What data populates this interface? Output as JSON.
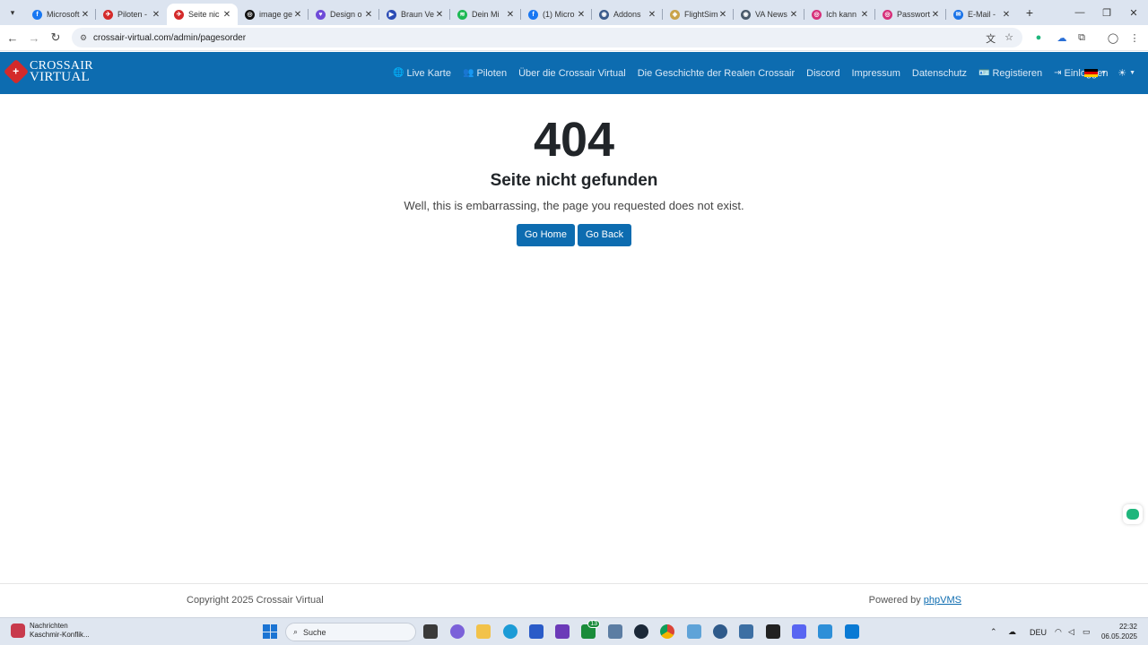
{
  "browser": {
    "tabs": [
      {
        "title": "Microsoft",
        "fav_color": "#1877f2",
        "fav_glyph": "f",
        "active": false
      },
      {
        "title": "Piloten -",
        "fav_color": "#d42a2a",
        "fav_glyph": "✈",
        "active": false
      },
      {
        "title": "Seite nic",
        "fav_color": "#d42a2a",
        "fav_glyph": "✈",
        "active": true
      },
      {
        "title": "image ge",
        "fav_color": "#111111",
        "fav_glyph": "◎",
        "active": false
      },
      {
        "title": "Design o",
        "fav_color": "#6e4bd8",
        "fav_glyph": "♥",
        "active": false
      },
      {
        "title": "Braun Ve",
        "fav_color": "#2a4bb5",
        "fav_glyph": "▶",
        "active": false
      },
      {
        "title": "Dein Mi",
        "fav_color": "#1db954",
        "fav_glyph": "≋",
        "active": false
      },
      {
        "title": "(1) Micro",
        "fav_color": "#1877f2",
        "fav_glyph": "f",
        "active": false
      },
      {
        "title": "Addons",
        "fav_color": "#3b5b8c",
        "fav_glyph": "◉",
        "active": false
      },
      {
        "title": "FlightSim",
        "fav_color": "#c9a34a",
        "fav_glyph": "◈",
        "active": false
      },
      {
        "title": "VA News",
        "fav_color": "#4a5a6a",
        "fav_glyph": "◉",
        "active": false
      },
      {
        "title": "Ich kann",
        "fav_color": "#d6307a",
        "fav_glyph": "◎",
        "active": false
      },
      {
        "title": "Passwort",
        "fav_color": "#d6307a",
        "fav_glyph": "◎",
        "active": false
      },
      {
        "title": "E-Mail -",
        "fav_color": "#1a73e8",
        "fav_glyph": "✉",
        "active": false
      }
    ],
    "url": "crossair-virtual.com/admin/pagesorder"
  },
  "site": {
    "logo_line1": "CROSSAIR",
    "logo_line2": "VIRTUAL",
    "nav": [
      {
        "label": "Live Karte",
        "icon": "🌐",
        "icon_name": "globe-icon",
        "key": "live-karte"
      },
      {
        "label": "Piloten",
        "icon": "👥",
        "icon_name": "users-icon",
        "key": "piloten"
      },
      {
        "label": "Über die Crossair Virtual",
        "icon": "",
        "icon_name": "",
        "key": "ueber"
      },
      {
        "label": "Die Geschichte der Realen Crossair",
        "icon": "",
        "icon_name": "",
        "key": "geschichte"
      },
      {
        "label": "Discord",
        "icon": "",
        "icon_name": "",
        "key": "discord"
      },
      {
        "label": "Impressum",
        "icon": "",
        "icon_name": "",
        "key": "impressum"
      },
      {
        "label": "Datenschutz",
        "icon": "",
        "icon_name": "",
        "key": "datenschutz"
      },
      {
        "label": "Registieren",
        "icon": "🪪",
        "icon_name": "id-card-icon",
        "key": "registieren"
      },
      {
        "label": "Einloggen",
        "icon": "⇥",
        "icon_name": "login-icon",
        "key": "einloggen"
      }
    ],
    "theme_icon": "☀",
    "primary_color": "#0d6cb0"
  },
  "error": {
    "code": "404",
    "title": "Seite nicht gefunden",
    "message": "Well, this is embarrassing, the page you requested does not exist.",
    "home_label": "Go Home",
    "back_label": "Go Back"
  },
  "footer": {
    "copyright": "Copyright 2025 Crossair Virtual",
    "powered_prefix": "Powered by",
    "powered_link": "phpVMS"
  },
  "taskbar": {
    "news_title": "Nachrichten",
    "news_sub": "Kaschmir-Konflik...",
    "search_placeholder": "Suche",
    "lang": "DEU",
    "time": "22:32",
    "date": "06.05.2025",
    "xbox_badge": "13"
  }
}
